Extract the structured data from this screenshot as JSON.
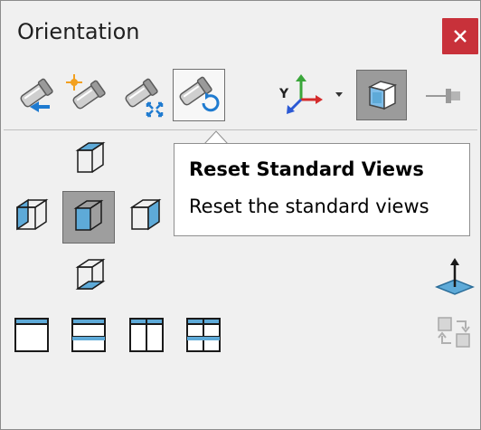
{
  "window": {
    "title": "Orientation"
  },
  "toolbar": {
    "items": [
      {
        "name": "new-view-button",
        "icon": "camera-arrow-left-icon"
      },
      {
        "name": "update-view-button",
        "icon": "camera-star-icon"
      },
      {
        "name": "zoom-to-fit-button",
        "icon": "camera-compress-icon"
      },
      {
        "name": "reset-standard-views-button",
        "icon": "camera-reset-icon",
        "state": "hover"
      },
      {
        "name": "view-selector-dropdown",
        "icon": "xyz-triad-icon"
      },
      {
        "name": "view-selector-toggle",
        "icon": "box-cube-icon",
        "state": "pressed"
      },
      {
        "name": "pin-button",
        "icon": "pin-icon"
      }
    ]
  },
  "tooltip": {
    "title": "Reset Standard Views",
    "description": "Reset the standard views"
  },
  "views": {
    "cube_views": [
      "top",
      "left",
      "front",
      "right",
      "bottom"
    ],
    "selected": "front",
    "viewport_layouts": [
      "single-view",
      "two-view-horizontal",
      "two-view-vertical",
      "four-view"
    ]
  },
  "side_buttons": [
    "normal-to-icon",
    "link-views-icon"
  ],
  "colors": {
    "close_bg": "#c8313a",
    "face_blue": "#5eaad8",
    "tooltip_bg": "#ffffff"
  }
}
